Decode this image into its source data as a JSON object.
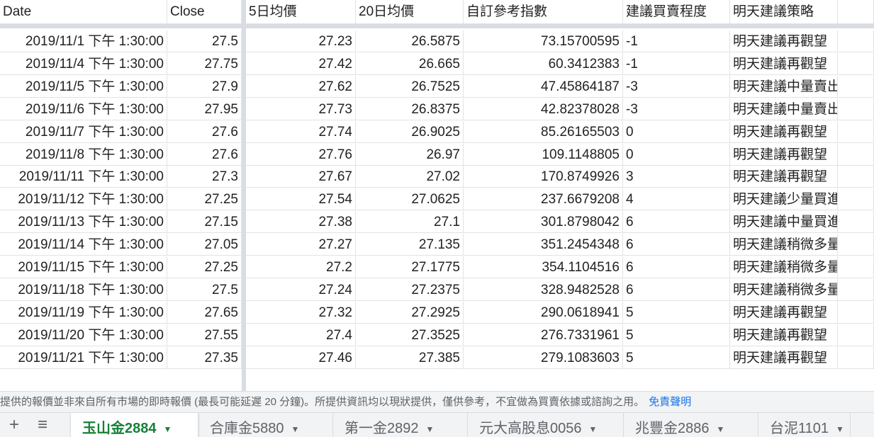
{
  "columns": [
    "Date",
    "Close",
    "5日均價",
    "20日均價",
    "自訂參考指數",
    "建議買賣程度",
    "明天建議策略"
  ],
  "rows": [
    [
      "2019/11/1 下午 1:30:00",
      "27.5",
      "27.23",
      "26.5875",
      "73.15700595",
      "-1",
      "明天建議再觀望"
    ],
    [
      "2019/11/4 下午 1:30:00",
      "27.75",
      "27.42",
      "26.665",
      "60.3412383",
      "-1",
      "明天建議再觀望"
    ],
    [
      "2019/11/5 下午 1:30:00",
      "27.9",
      "27.62",
      "26.7525",
      "47.45864187",
      "-3",
      "明天建議中量賣出"
    ],
    [
      "2019/11/6 下午 1:30:00",
      "27.95",
      "27.73",
      "26.8375",
      "42.82378028",
      "-3",
      "明天建議中量賣出"
    ],
    [
      "2019/11/7 下午 1:30:00",
      "27.6",
      "27.74",
      "26.9025",
      "85.26165503",
      "0",
      "明天建議再觀望"
    ],
    [
      "2019/11/8 下午 1:30:00",
      "27.6",
      "27.76",
      "26.97",
      "109.1148805",
      "0",
      "明天建議再觀望"
    ],
    [
      "2019/11/11 下午 1:30:00",
      "27.3",
      "27.67",
      "27.02",
      "170.8749926",
      "3",
      "明天建議再觀望"
    ],
    [
      "2019/11/12 下午 1:30:00",
      "27.25",
      "27.54",
      "27.0625",
      "237.6679208",
      "4",
      "明天建議少量買進"
    ],
    [
      "2019/11/13 下午 1:30:00",
      "27.15",
      "27.38",
      "27.1",
      "301.8798042",
      "6",
      "明天建議中量買進"
    ],
    [
      "2019/11/14 下午 1:30:00",
      "27.05",
      "27.27",
      "27.135",
      "351.2454348",
      "6",
      "明天建議稍微多量買進"
    ],
    [
      "2019/11/15 下午 1:30:00",
      "27.25",
      "27.2",
      "27.1775",
      "354.1104516",
      "6",
      "明天建議稍微多量買進"
    ],
    [
      "2019/11/18 下午 1:30:00",
      "27.5",
      "27.24",
      "27.2375",
      "328.9482528",
      "6",
      "明天建議稍微多量買進"
    ],
    [
      "2019/11/19 下午 1:30:00",
      "27.65",
      "27.32",
      "27.2925",
      "290.0618941",
      "5",
      "明天建議再觀望"
    ],
    [
      "2019/11/20 下午 1:30:00",
      "27.55",
      "27.4",
      "27.3525",
      "276.7331961",
      "5",
      "明天建議再觀望"
    ],
    [
      "2019/11/21 下午 1:30:00",
      "27.35",
      "27.46",
      "27.385",
      "279.1083603",
      "5",
      "明天建議再觀望"
    ]
  ],
  "disclaimer": {
    "text": "提供的報價並非來自所有市場的即時報價 (最長可能延遲 20 分鐘)。所提供資訊均以現狀提供，僅供參考，不宜做為買賣依據或諮詢之用。",
    "link": "免責聲明"
  },
  "toolbar": {
    "add_icon": "+",
    "menu_icon": "≡"
  },
  "sheets": [
    "玉山金2884",
    "合庫金5880",
    "第一金2892",
    "元大高股息0056",
    "兆豐金2886",
    "台泥1101"
  ],
  "active_sheet": 0,
  "colors": {
    "active_tab_text": "#188038",
    "link": "#1a73e8",
    "freeze_bar": "#d9dde3"
  }
}
